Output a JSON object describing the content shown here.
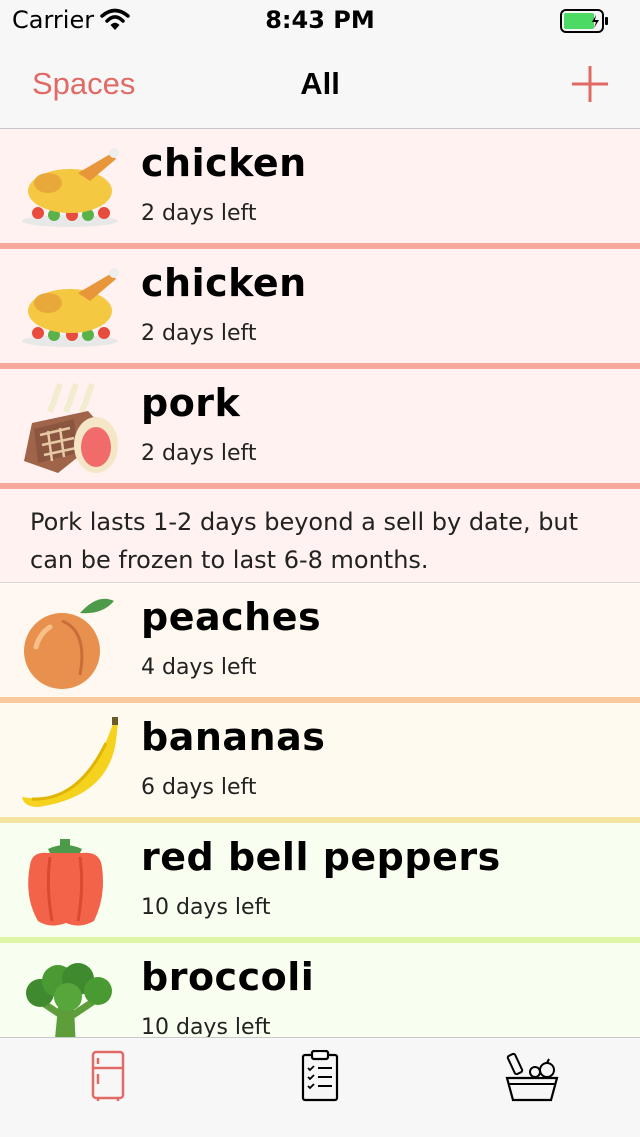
{
  "status": {
    "carrier": "Carrier",
    "time": "8:43 PM"
  },
  "nav": {
    "back_label": "Spaces",
    "title": "All"
  },
  "items": [
    {
      "name": "chicken",
      "days": "2 days left",
      "icon": "roast-chicken-icon"
    },
    {
      "name": "chicken",
      "days": "2 days left",
      "icon": "roast-chicken-icon"
    },
    {
      "name": "pork",
      "days": "2 days left",
      "icon": "pork-roast-icon"
    },
    {
      "name": "peaches",
      "days": "4 days left",
      "icon": "peach-icon"
    },
    {
      "name": "bananas",
      "days": "6 days left",
      "icon": "banana-icon"
    },
    {
      "name": "red bell peppers",
      "days": "10 days left",
      "icon": "bell-pepper-icon"
    },
    {
      "name": "broccoli",
      "days": "10 days left",
      "icon": "broccoli-icon"
    }
  ],
  "tip": {
    "text": "Pork lasts 1-2 days beyond a sell by date, but can be frozen to last 6-8 months."
  },
  "tabs": [
    {
      "icon": "fridge-icon",
      "selected": true
    },
    {
      "icon": "clipboard-checklist-icon",
      "selected": false
    },
    {
      "icon": "grocery-basket-icon",
      "selected": false
    }
  ],
  "colors": {
    "accent": "#e06a66",
    "red_zone": "#f6a89d",
    "orange_zone": "#f8c99c",
    "yellow_zone": "#f3e3a0",
    "green_zone": "#dff5a8"
  }
}
